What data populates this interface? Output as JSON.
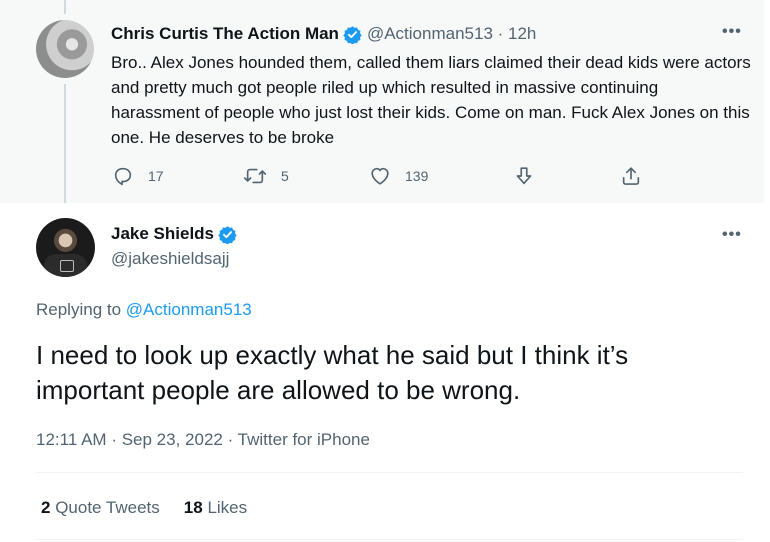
{
  "parent_tweet": {
    "author_name": "Chris Curtis The Action Man",
    "handle": "@Actionman513",
    "time": "12h",
    "more": "•••",
    "text": "Bro.. Alex Jones hounded them, called them liars claimed their dead kids were actors and pretty much got people riled up which resulted in massive continuing harassment of people who just lost their kids. Come on man. Fuck Alex Jones on this one. He deserves to be broke",
    "reply_count": "17",
    "retweet_count": "5",
    "like_count": "139"
  },
  "reply_tweet": {
    "author_name": "Jake Shields",
    "handle": "@jakeshieldsajj",
    "more": "•••",
    "replying_label": "Replying to",
    "replying_handle": "@Actionman513",
    "text": "I need to look up exactly what he said but I think it’s important people are allowed to be wrong.",
    "time": "12:11 AM",
    "date": "Sep 23, 2022",
    "source": "Twitter for iPhone",
    "quote_tweets_count": "2",
    "quote_tweets_label": "Quote Tweets",
    "likes_count": "18",
    "likes_label": "Likes"
  },
  "colors": {
    "accent": "#1d9bf0",
    "muted": "#536471",
    "text": "#0f1419",
    "parent_background": "#f7f9f9"
  }
}
